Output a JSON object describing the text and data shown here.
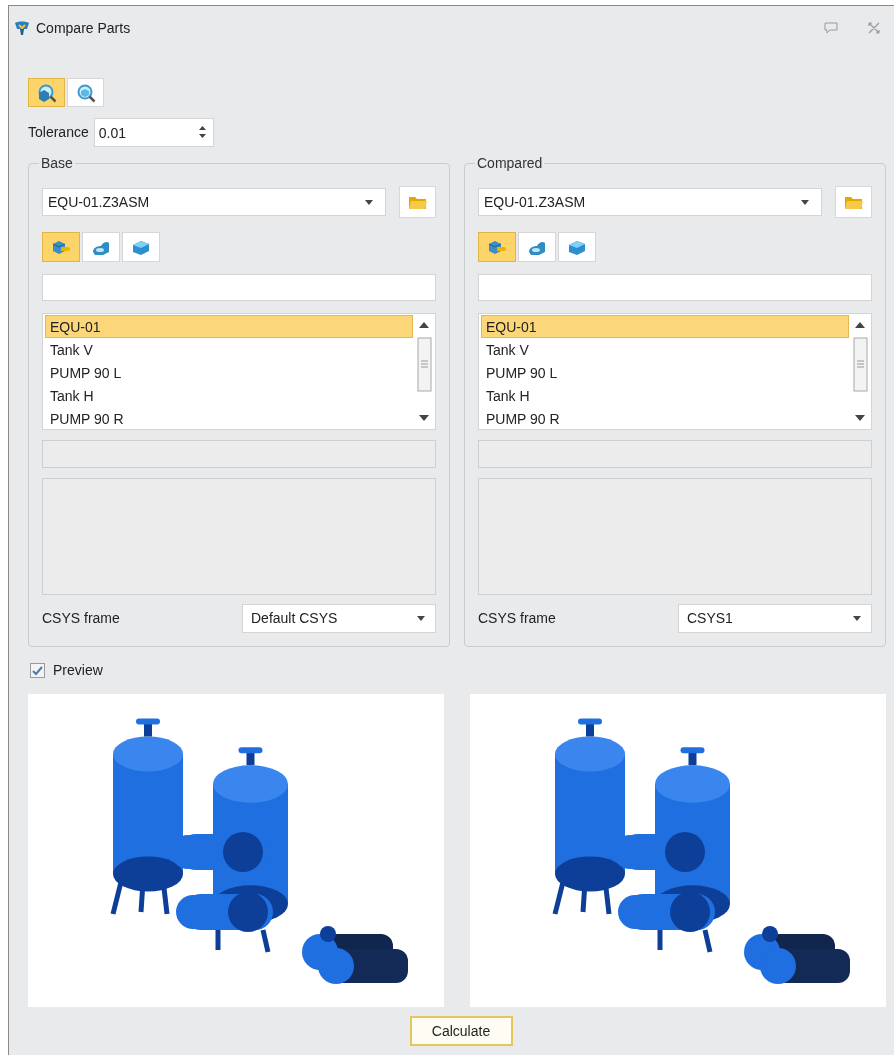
{
  "window": {
    "title": "Compare Parts"
  },
  "mode_buttons": [
    {
      "selected": true
    },
    {
      "selected": false
    }
  ],
  "tolerance": {
    "label": "Tolerance",
    "value": "0.01"
  },
  "panels": [
    {
      "title": "Base",
      "file": "EQU-01.Z3ASM",
      "filter_buttons": [
        {
          "selected": true
        },
        {
          "selected": false
        },
        {
          "selected": false
        }
      ],
      "parts": [
        {
          "label": "EQU-01",
          "selected": true
        },
        {
          "label": "Tank V",
          "selected": false
        },
        {
          "label": "PUMP 90 L",
          "selected": false
        },
        {
          "label": "Tank H",
          "selected": false
        },
        {
          "label": "PUMP 90 R",
          "selected": false
        }
      ],
      "csys_label": "CSYS frame",
      "csys_value": "Default CSYS"
    },
    {
      "title": "Compared",
      "file": "EQU-01.Z3ASM",
      "filter_buttons": [
        {
          "selected": true
        },
        {
          "selected": false
        },
        {
          "selected": false
        }
      ],
      "parts": [
        {
          "label": "EQU-01",
          "selected": true
        },
        {
          "label": "Tank V",
          "selected": false
        },
        {
          "label": "PUMP 90 L",
          "selected": false
        },
        {
          "label": "Tank H",
          "selected": false
        },
        {
          "label": "PUMP 90 R",
          "selected": false
        }
      ],
      "csys_label": "CSYS frame",
      "csys_value": "CSYS1"
    }
  ],
  "preview": {
    "label": "Preview",
    "checked": true
  },
  "calculate_button": "Calculate"
}
